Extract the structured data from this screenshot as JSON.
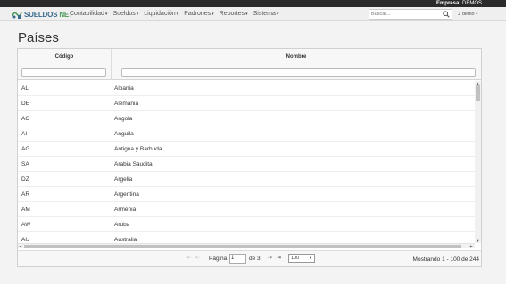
{
  "company": {
    "label": "Empresa:",
    "value": "DEMOS"
  },
  "brand": {
    "name_part1": "SUELDOS",
    "name_part2": "NET"
  },
  "menu": [
    {
      "label": "Contabilidad"
    },
    {
      "label": "Sueldos"
    },
    {
      "label": "Liquidación"
    },
    {
      "label": "Padrones"
    },
    {
      "label": "Reportes"
    },
    {
      "label": "Sistema"
    }
  ],
  "search": {
    "placeholder": "Buscar..."
  },
  "user": {
    "name": "demo"
  },
  "page": {
    "title": "Países"
  },
  "table": {
    "columns": [
      "Código",
      "Nombre"
    ],
    "rows": [
      {
        "code": "AL",
        "name": "Albania"
      },
      {
        "code": "DE",
        "name": "Alemania"
      },
      {
        "code": "AO",
        "name": "Angola"
      },
      {
        "code": "AI",
        "name": "Anguila"
      },
      {
        "code": "AG",
        "name": "Antigua y Barbuda"
      },
      {
        "code": "SA",
        "name": "Arabia Saudita"
      },
      {
        "code": "DZ",
        "name": "Argelia"
      },
      {
        "code": "AR",
        "name": "Argentina"
      },
      {
        "code": "AM",
        "name": "Armenia"
      },
      {
        "code": "AW",
        "name": "Aruba"
      },
      {
        "code": "AU",
        "name": "Australia"
      }
    ]
  },
  "pager": {
    "page_label": "Página",
    "current_page": "1",
    "of_label": "de 3",
    "page_size": "100",
    "summary": "Mostrando 1 - 100 de 244"
  },
  "colors": {
    "topbar": "#2b2b2b",
    "brand_blue": "#3a6b8f",
    "brand_green": "#4a9a5a"
  }
}
